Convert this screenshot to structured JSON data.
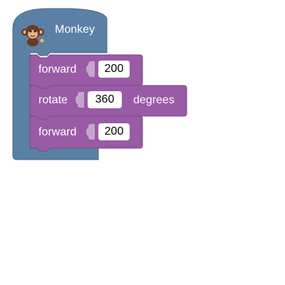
{
  "sprite": {
    "name": "Monkey",
    "avatar_icon": "monkey-icon",
    "color": "#5b80a5"
  },
  "statements": [
    {
      "command": "forward",
      "value": "200",
      "suffix": ""
    },
    {
      "command": "rotate",
      "value": "360",
      "suffix": "degrees"
    },
    {
      "command": "forward",
      "value": "200",
      "suffix": ""
    }
  ],
  "colors": {
    "event_block": "#5b80a5",
    "motion_block": "#995ba5",
    "input_field": "#ffffff"
  }
}
